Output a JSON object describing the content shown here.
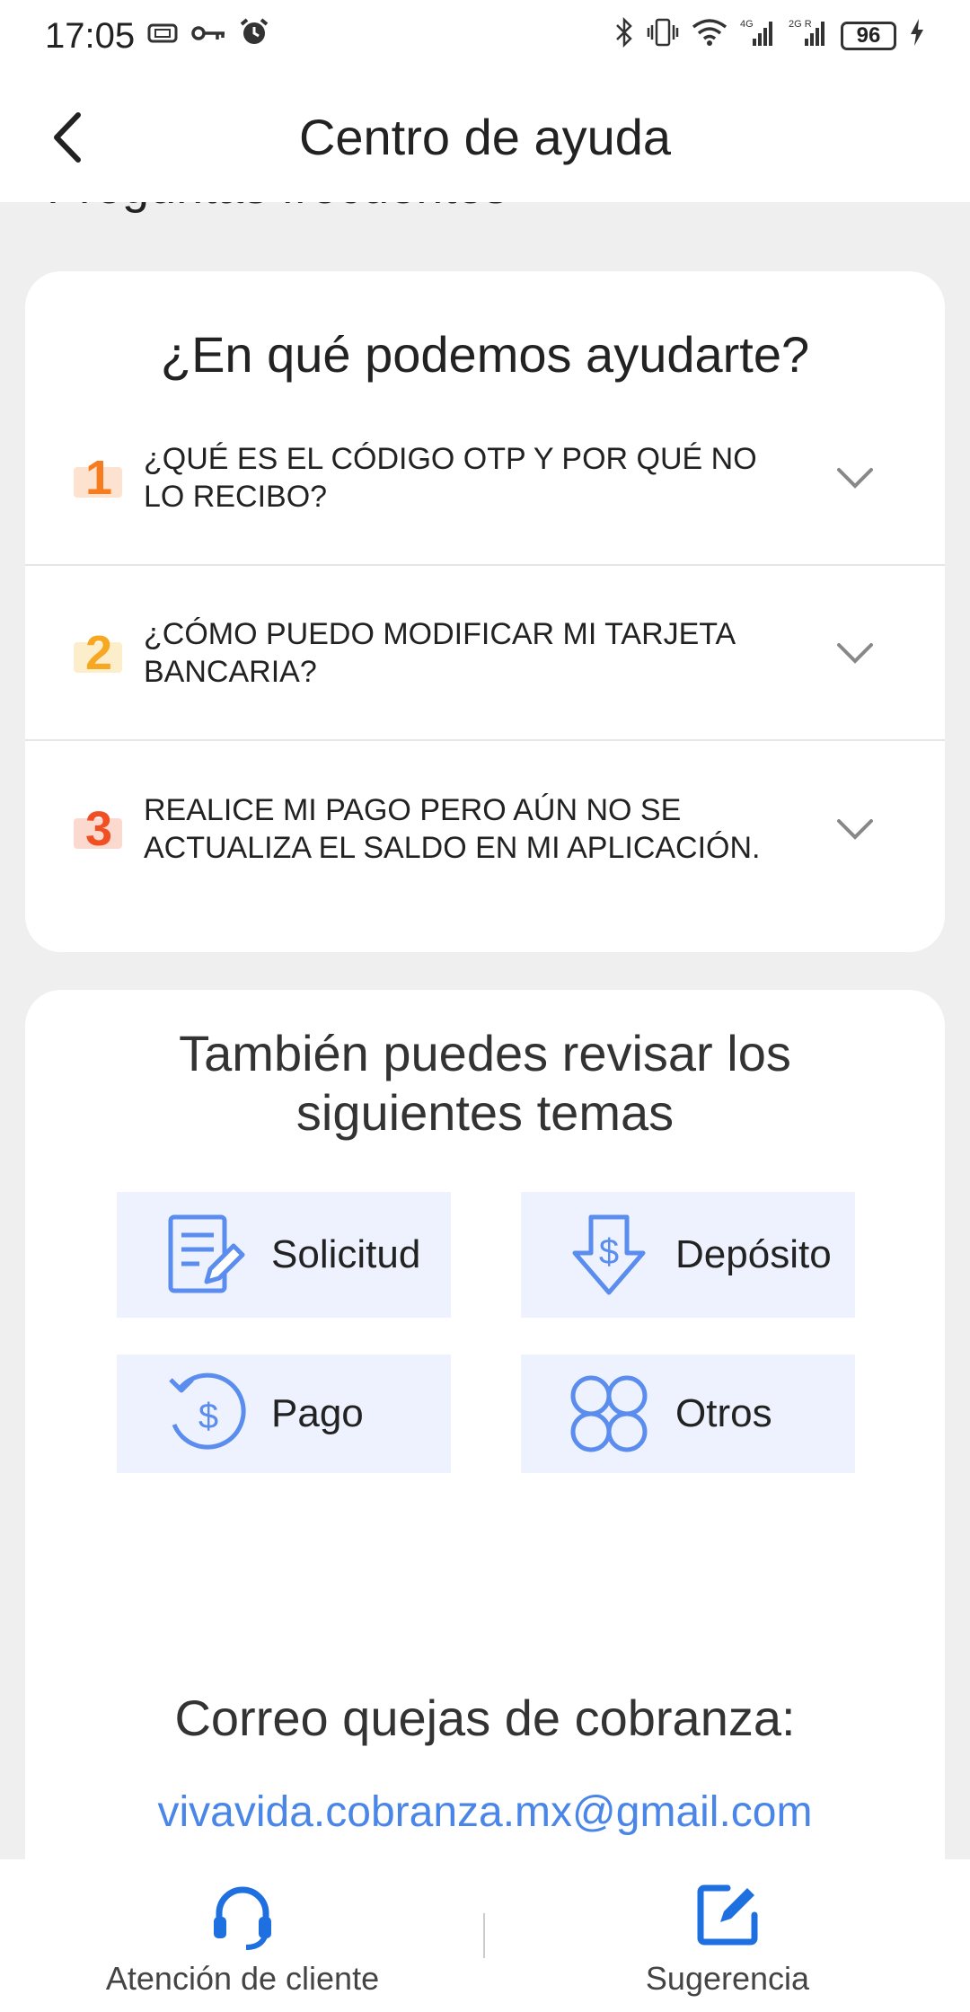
{
  "status_bar": {
    "time": "17:05",
    "battery": "96",
    "left_icons": [
      "sim-card-icon",
      "key-icon",
      "alarm-icon"
    ],
    "right_icons": [
      "bluetooth-icon",
      "vibrate-icon",
      "wifi-icon",
      "signal-4g-icon",
      "signal-2g-icon",
      "charging-icon"
    ],
    "net_4g": "4G",
    "net_2g": "2G R"
  },
  "header": {
    "title": "Centro de ayuda",
    "back_icon": "chevron-left-icon"
  },
  "partial_heading": "Preguntas frecuentes",
  "faq": {
    "title": "¿En qué podemos ayudarte?",
    "items": [
      {
        "number": "1",
        "text": "¿QUÉ ES EL CÓDIGO OTP Y POR QUÉ NO LO RECIBO?",
        "color": "#f57c1f"
      },
      {
        "number": "2",
        "text": "¿CÓMO PUEDO MODIFICAR MI TARJETA BANCARIA?",
        "color": "#f7a823"
      },
      {
        "number": "3",
        "text": "REALICE MI PAGO PERO AÚN NO SE ACTUALIZA EL SALDO EN MI APLICACIÓN.",
        "color": "#f04e23"
      }
    ]
  },
  "topics": {
    "title": "También puedes revisar los siguientes temas",
    "items": [
      {
        "label": "Solicitud",
        "icon": "document-edit-icon"
      },
      {
        "label": "Depósito",
        "icon": "dollar-down-arrow-icon"
      },
      {
        "label": "Pago",
        "icon": "dollar-refresh-icon"
      },
      {
        "label": "Otros",
        "icon": "four-circles-icon"
      }
    ],
    "accent_color": "#5b8def",
    "tile_color": "#edf2fe"
  },
  "mail": {
    "title": "Correo quejas de cobranza:",
    "email": "vivavida.cobranza.mx@gmail.com"
  },
  "bottom_bar": {
    "items": [
      {
        "label": "Atención de cliente",
        "icon": "headset-icon"
      },
      {
        "label": "Sugerencia",
        "icon": "edit-square-icon"
      }
    ],
    "icon_color": "#1e6fe0"
  }
}
